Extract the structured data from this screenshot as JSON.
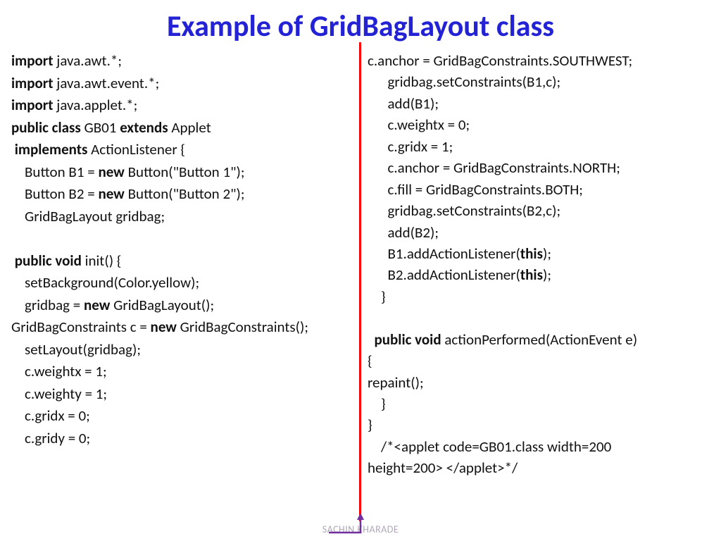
{
  "title": "Example of GridBagLayout class",
  "left": {
    "l1a": "import",
    "l1b": " java.awt.*;",
    "l2a": "import",
    "l2b": " java.awt.event.*;",
    "l3a": "import",
    "l3b": " java.applet.*;",
    "l4a": "public class",
    "l4b": " GB01 ",
    "l4c": "extends",
    "l4d": " Applet",
    "l5a": " implements",
    "l5b": " ActionListener {",
    "l6a": "    Button B1 = ",
    "l6b": "new",
    "l6c": " Button(\"Button 1\");",
    "l7a": "    Button B2 = ",
    "l7b": "new",
    "l7c": " Button(\"Button 2\");",
    "l8": "    GridBagLayout gridbag;",
    "l9": " ",
    "l10a": " public void",
    "l10b": " init() {",
    "l11": "    setBackground(Color.yellow);",
    "l12a": "    gridbag = ",
    "l12b": "new",
    "l12c": " GridBagLayout();",
    "l13a": "GridBagConstraints c = ",
    "l13b": "new",
    "l13c": " GridBagConstraints();",
    "l14": "    setLayout(gridbag);",
    "l15": "    c.weightx = 1;",
    "l16": "    c.weighty = 1;",
    "l17": "    c.gridx = 0;",
    "l18": "    c.gridy = 0;"
  },
  "right": {
    "r1": "c.anchor = GridBagConstraints.SOUTHWEST;",
    "r2": "      gridbag.setConstraints(B1,c);",
    "r3": "      add(B1);",
    "r4": "      c.weightx = 0;",
    "r5": "      c.gridx = 1;",
    "r6": "      c.anchor = GridBagConstraints.NORTH;",
    "r7": "      c.fill = GridBagConstraints.BOTH;",
    "r8": "      gridbag.setConstraints(B2,c);",
    "r9": "      add(B2);",
    "r10a": "      B1.addActionListener(",
    "r10b": "this",
    "r10c": ");",
    "r11a": "      B2.addActionListener(",
    "r11b": "this",
    "r11c": ");",
    "r12": "    }",
    "r13": " ",
    "r14a": "  public void",
    "r14b": " actionPerformed(ActionEvent e)",
    "r15": "{",
    "r16": "repaint();",
    "r17": "    }",
    "r18": "}",
    "r19": "    /*<applet code=GB01.class width=200",
    "r20": "height=200> </applet>*/"
  },
  "footer": "SACHIN KHARADE"
}
